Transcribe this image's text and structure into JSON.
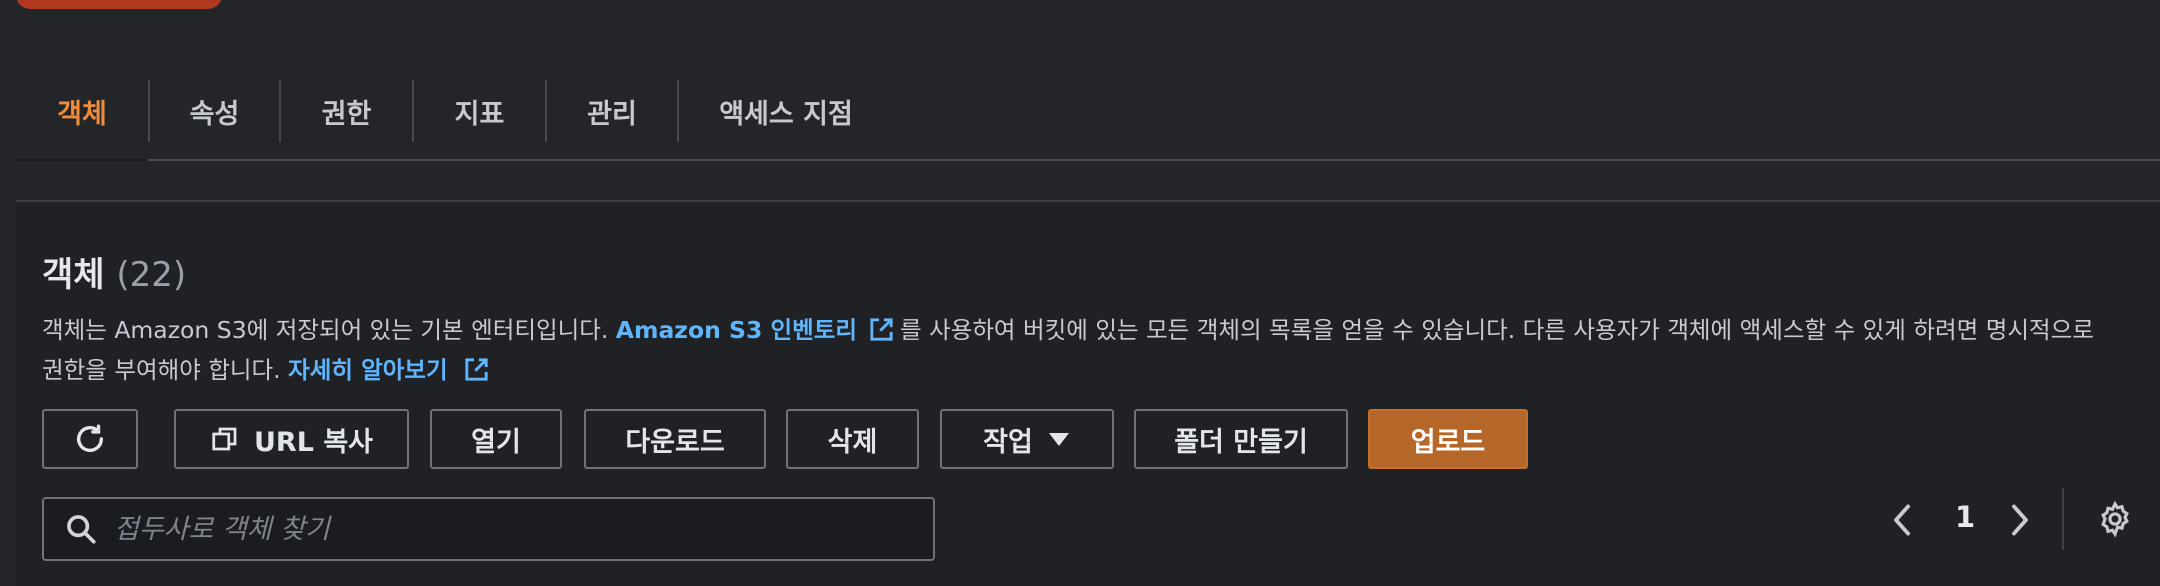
{
  "tabs": [
    {
      "label": "객체",
      "active": true
    },
    {
      "label": "속성",
      "active": false
    },
    {
      "label": "권한",
      "active": false
    },
    {
      "label": "지표",
      "active": false
    },
    {
      "label": "관리",
      "active": false
    },
    {
      "label": "액세스 지점",
      "active": false
    }
  ],
  "section": {
    "title": "객체",
    "count": "(22)",
    "desc_part1": "객체는 Amazon S3에 저장되어 있는 기본 엔터티입니다. ",
    "inventory_link": "Amazon S3 인벤토리",
    "desc_part2": "를 사용하여 버킷에 있는 모든 객체의 목록을 얻을 수 있습니다. 다른 사용자가 객체에 액세스할 수 있게 하려면 명시적으로 권한을 부여해야 합니다. ",
    "learn_more_link": "자세히 알아보기"
  },
  "toolbar": {
    "copy_url": "URL 복사",
    "open": "열기",
    "download": "다운로드",
    "delete": "삭제",
    "actions": "작업",
    "create_folder": "폴더 만들기",
    "upload": "업로드"
  },
  "search": {
    "placeholder": "접두사로 객체 찾기",
    "value": ""
  },
  "pagination": {
    "current_page": "1"
  },
  "colors": {
    "accent_orange": "#ef8c3a",
    "primary_button": "#b5672a",
    "link_blue": "#5fb5ff",
    "background": "#232529"
  }
}
